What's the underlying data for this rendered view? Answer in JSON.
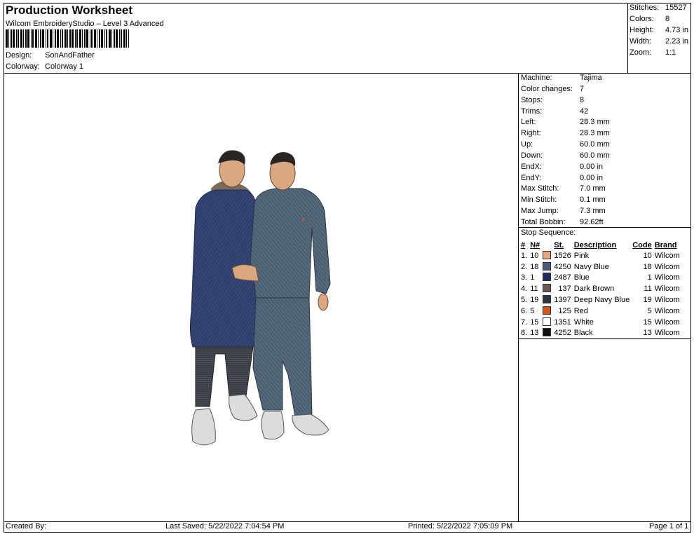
{
  "header": {
    "title": "Production Worksheet",
    "subtitle": "Wilcom EmbroideryStudio – Level 3 Advanced",
    "design_label": "Design:",
    "design_value": "SonAndFather",
    "colorway_label": "Colorway:",
    "colorway_value": "Colorway 1"
  },
  "stats": [
    {
      "label": "Stitches:",
      "value": "15527"
    },
    {
      "label": "Colors:",
      "value": "8"
    },
    {
      "label": "Height:",
      "value": "4.73 in"
    },
    {
      "label": "Width:",
      "value": "2.23 in"
    },
    {
      "label": "Zoom:",
      "value": "1:1"
    }
  ],
  "machine_info": [
    {
      "label": "Machine:",
      "value": "Tajima"
    },
    {
      "label": "Color changes:",
      "value": "7"
    },
    {
      "label": "Stops:",
      "value": "8"
    },
    {
      "label": "Trims:",
      "value": "42"
    },
    {
      "label": "Left:",
      "value": "28.3 mm"
    },
    {
      "label": "Right:",
      "value": "28.3 mm"
    },
    {
      "label": "Up:",
      "value": "60.0 mm"
    },
    {
      "label": "Down:",
      "value": "60.0 mm"
    },
    {
      "label": "EndX:",
      "value": "0.00 in"
    },
    {
      "label": "EndY:",
      "value": "0.00 in"
    },
    {
      "label": "Max Stitch:",
      "value": "7.0 mm"
    },
    {
      "label": "Min Stitch:",
      "value": "0.1 mm"
    },
    {
      "label": "Max Jump:",
      "value": "7.3 mm"
    },
    {
      "label": "Total Bobbin:",
      "value": "92.62ft"
    }
  ],
  "stop_sequence": {
    "title": "Stop Sequence:",
    "headers": {
      "num": "#",
      "n": "N#",
      "st": "St.",
      "desc": "Description",
      "code": "Code",
      "brand": "Brand"
    },
    "rows": [
      {
        "num": "1.",
        "n": "10",
        "color": "#e8a882",
        "st": "1526",
        "desc": "Pink",
        "code": "10",
        "brand": "Wilcom"
      },
      {
        "num": "2.",
        "n": "18",
        "color": "#4a5a78",
        "st": "4250",
        "desc": "Navy Blue",
        "code": "18",
        "brand": "Wilcom"
      },
      {
        "num": "3.",
        "n": "1",
        "color": "#1f2c5a",
        "st": "2487",
        "desc": "Blue",
        "code": "1",
        "brand": "Wilcom"
      },
      {
        "num": "4.",
        "n": "11",
        "color": "#6e5a52",
        "st": "137",
        "desc": "Dark Brown",
        "code": "11",
        "brand": "Wilcom"
      },
      {
        "num": "5.",
        "n": "19",
        "color": "#2e3440",
        "st": "1397",
        "desc": "Deep Navy Blue",
        "code": "19",
        "brand": "Wilcom"
      },
      {
        "num": "6.",
        "n": "5",
        "color": "#d2561e",
        "st": "125",
        "desc": "Red",
        "code": "5",
        "brand": "Wilcom"
      },
      {
        "num": "7.",
        "n": "15",
        "color": "#ffffff",
        "st": "1351",
        "desc": "White",
        "code": "15",
        "brand": "Wilcom"
      },
      {
        "num": "8.",
        "n": "13",
        "color": "#111111",
        "st": "4252",
        "desc": "Black",
        "code": "13",
        "brand": "Wilcom"
      }
    ]
  },
  "footer": {
    "created_by": "Created By:",
    "last_saved": "Last Saved: 5/22/2022 7:04:54 PM",
    "printed": "Printed: 5/22/2022 7:05:09 PM",
    "page": "Page 1 of 1"
  },
  "colors": {
    "coat_navy": "#2f3e6c",
    "jacket_grey_blue": "#4c5f72",
    "pants_dark": "#3a3f46",
    "skin": "#d9a880",
    "hair": "#2a2522",
    "hood_brown": "#7a6a5a",
    "shoe": "#dcdcdc"
  }
}
